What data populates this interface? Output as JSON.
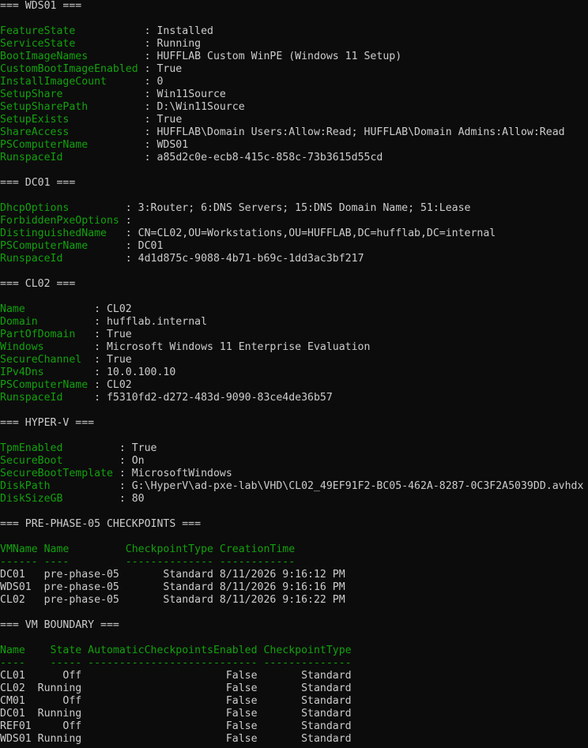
{
  "colors": {
    "background": "#0c0c0c",
    "text": "#cccccc",
    "label": "#13a10e"
  },
  "lines": [
    {
      "segments": [
        {
          "t": "=== WDS01 ===",
          "c": "white"
        }
      ]
    },
    {
      "segments": []
    },
    {
      "segments": [
        {
          "t": "FeatureState",
          "c": "green"
        },
        {
          "t": "           : Installed",
          "c": "white"
        }
      ]
    },
    {
      "segments": [
        {
          "t": "ServiceState",
          "c": "green"
        },
        {
          "t": "           : Running",
          "c": "white"
        }
      ]
    },
    {
      "segments": [
        {
          "t": "BootImageNames",
          "c": "green"
        },
        {
          "t": "         : HUFFLAB Custom WinPE (Windows 11 Setup)",
          "c": "white"
        }
      ]
    },
    {
      "segments": [
        {
          "t": "CustomBootImageEnabled",
          "c": "green"
        },
        {
          "t": " : True",
          "c": "white"
        }
      ]
    },
    {
      "segments": [
        {
          "t": "InstallImageCount",
          "c": "green"
        },
        {
          "t": "      : 0",
          "c": "white"
        }
      ]
    },
    {
      "segments": [
        {
          "t": "SetupShare",
          "c": "green"
        },
        {
          "t": "             : Win11Source",
          "c": "white"
        }
      ]
    },
    {
      "segments": [
        {
          "t": "SetupSharePath",
          "c": "green"
        },
        {
          "t": "         : D:\\Win11Source",
          "c": "white"
        }
      ]
    },
    {
      "segments": [
        {
          "t": "SetupExists",
          "c": "green"
        },
        {
          "t": "            : True",
          "c": "white"
        }
      ]
    },
    {
      "segments": [
        {
          "t": "ShareAccess",
          "c": "green"
        },
        {
          "t": "            : HUFFLAB\\Domain Users:Allow:Read; HUFFLAB\\Domain Admins:Allow:Read",
          "c": "white"
        }
      ]
    },
    {
      "segments": [
        {
          "t": "PSComputerName",
          "c": "green"
        },
        {
          "t": "         : WDS01",
          "c": "white"
        }
      ]
    },
    {
      "segments": [
        {
          "t": "RunspaceId",
          "c": "green"
        },
        {
          "t": "             : a85d2c0e-ecb8-415c-858c-73b3615d55cd",
          "c": "white"
        }
      ]
    },
    {
      "segments": []
    },
    {
      "segments": [
        {
          "t": "=== DC01 ===",
          "c": "white"
        }
      ]
    },
    {
      "segments": []
    },
    {
      "segments": [
        {
          "t": "DhcpOptions",
          "c": "green"
        },
        {
          "t": "         : 3:Router; 6:DNS Servers; 15:DNS Domain Name; 51:Lease",
          "c": "white"
        }
      ]
    },
    {
      "segments": [
        {
          "t": "ForbiddenPxeOptions",
          "c": "green"
        },
        {
          "t": " :",
          "c": "white"
        }
      ]
    },
    {
      "segments": [
        {
          "t": "DistinguishedName",
          "c": "green"
        },
        {
          "t": "   : CN=CL02,OU=Workstations,OU=HUFFLAB,DC=hufflab,DC=internal",
          "c": "white"
        }
      ]
    },
    {
      "segments": [
        {
          "t": "PSComputerName",
          "c": "green"
        },
        {
          "t": "      : DC01",
          "c": "white"
        }
      ]
    },
    {
      "segments": [
        {
          "t": "RunspaceId",
          "c": "green"
        },
        {
          "t": "          : 4d1d875c-9088-4b71-b69c-1dd3ac3bf217",
          "c": "white"
        }
      ]
    },
    {
      "segments": []
    },
    {
      "segments": [
        {
          "t": "=== CL02 ===",
          "c": "white"
        }
      ]
    },
    {
      "segments": []
    },
    {
      "segments": [
        {
          "t": "Name",
          "c": "green"
        },
        {
          "t": "           : CL02",
          "c": "white"
        }
      ]
    },
    {
      "segments": [
        {
          "t": "Domain",
          "c": "green"
        },
        {
          "t": "         : hufflab.internal",
          "c": "white"
        }
      ]
    },
    {
      "segments": [
        {
          "t": "PartOfDomain",
          "c": "green"
        },
        {
          "t": "   : True",
          "c": "white"
        }
      ]
    },
    {
      "segments": [
        {
          "t": "Windows",
          "c": "green"
        },
        {
          "t": "        : Microsoft Windows 11 Enterprise Evaluation",
          "c": "white"
        }
      ]
    },
    {
      "segments": [
        {
          "t": "SecureChannel",
          "c": "green"
        },
        {
          "t": "  : True",
          "c": "white"
        }
      ]
    },
    {
      "segments": [
        {
          "t": "IPv4Dns",
          "c": "green"
        },
        {
          "t": "        : 10.0.100.10",
          "c": "white"
        }
      ]
    },
    {
      "segments": [
        {
          "t": "PSComputerName",
          "c": "green"
        },
        {
          "t": " : CL02",
          "c": "white"
        }
      ]
    },
    {
      "segments": [
        {
          "t": "RunspaceId",
          "c": "green"
        },
        {
          "t": "     : f5310fd2-d272-483d-9090-83ce4de36b57",
          "c": "white"
        }
      ]
    },
    {
      "segments": []
    },
    {
      "segments": [
        {
          "t": "=== HYPER-V ===",
          "c": "white"
        }
      ]
    },
    {
      "segments": []
    },
    {
      "segments": [
        {
          "t": "TpmEnabled",
          "c": "green"
        },
        {
          "t": "         : True",
          "c": "white"
        }
      ]
    },
    {
      "segments": [
        {
          "t": "SecureBoot",
          "c": "green"
        },
        {
          "t": "         : On",
          "c": "white"
        }
      ]
    },
    {
      "segments": [
        {
          "t": "SecureBootTemplate",
          "c": "green"
        },
        {
          "t": " : MicrosoftWindows",
          "c": "white"
        }
      ]
    },
    {
      "segments": [
        {
          "t": "DiskPath",
          "c": "green"
        },
        {
          "t": "           : G:\\HyperV\\ad-pxe-lab\\VHD\\CL02_49EF91F2-BC05-462A-8287-0C3F2A5039DD.avhdx",
          "c": "white"
        }
      ]
    },
    {
      "segments": [
        {
          "t": "DiskSizeGB",
          "c": "green"
        },
        {
          "t": "         : 80",
          "c": "white"
        }
      ]
    },
    {
      "segments": []
    },
    {
      "segments": [
        {
          "t": "=== PRE-PHASE-05 CHECKPOINTS ===",
          "c": "white"
        }
      ]
    },
    {
      "segments": []
    },
    {
      "segments": [
        {
          "t": "VMName Name         CheckpointType CreationTime",
          "c": "green"
        }
      ]
    },
    {
      "segments": [
        {
          "t": "------ ----         -------------- ------------",
          "c": "green"
        }
      ]
    },
    {
      "segments": [
        {
          "t": "DC01   pre-phase-05       Standard 8/11/2026 9:16:12 PM",
          "c": "white"
        }
      ]
    },
    {
      "segments": [
        {
          "t": "WDS01  pre-phase-05       Standard 8/11/2026 9:16:16 PM",
          "c": "white"
        }
      ]
    },
    {
      "segments": [
        {
          "t": "CL02   pre-phase-05       Standard 8/11/2026 9:16:22 PM",
          "c": "white"
        }
      ]
    },
    {
      "segments": []
    },
    {
      "segments": [
        {
          "t": "=== VM BOUNDARY ===",
          "c": "white"
        }
      ]
    },
    {
      "segments": []
    },
    {
      "segments": [
        {
          "t": "Name    State AutomaticCheckpointsEnabled CheckpointType",
          "c": "green"
        }
      ]
    },
    {
      "segments": [
        {
          "t": "----    ----- --------------------------- --------------",
          "c": "green"
        }
      ]
    },
    {
      "segments": [
        {
          "t": "CL01      Off                       False       Standard",
          "c": "white"
        }
      ]
    },
    {
      "segments": [
        {
          "t": "CL02  Running                       False       Standard",
          "c": "white"
        }
      ]
    },
    {
      "segments": [
        {
          "t": "CM01      Off                       False       Standard",
          "c": "white"
        }
      ]
    },
    {
      "segments": [
        {
          "t": "DC01  Running                       False       Standard",
          "c": "white"
        }
      ]
    },
    {
      "segments": [
        {
          "t": "REF01     Off                       False       Standard",
          "c": "white"
        }
      ]
    },
    {
      "segments": [
        {
          "t": "WDS01 Running                       False       Standard",
          "c": "white"
        }
      ]
    }
  ]
}
